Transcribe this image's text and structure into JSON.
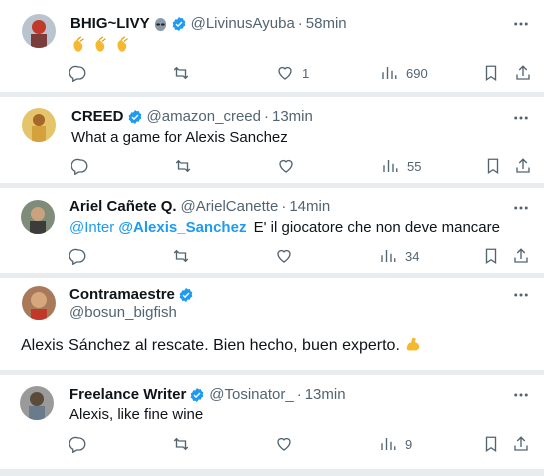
{
  "tweets": [
    {
      "name": "BHIG~LIVY",
      "handle": "@LivinusAyuba",
      "dot": "·",
      "time": "58min",
      "text": "",
      "emoji": [
        "clapping-hands",
        "clapping-hands",
        "clapping-hands"
      ],
      "replies": "",
      "retweets": "",
      "likes": "1",
      "views": "690"
    },
    {
      "name": "CREED",
      "handle": "@amazon_creed",
      "dot": "·",
      "time": "13min",
      "text": "What a game for Alexis Sanchez",
      "replies": "",
      "retweets": "",
      "likes": "",
      "views": "55"
    },
    {
      "name": "Ariel Cañete Q.",
      "handle": "@ArielCanette",
      "dot": "·",
      "time": "14min",
      "mention1": "@Inter",
      "mention2": "@Alexis_Sanchez",
      "text": "E' il giocatore che non deve mancare",
      "replies": "",
      "retweets": "",
      "likes": "",
      "views": "34"
    },
    {
      "name": "Contramaestre",
      "handle": "@bosun_bigfish",
      "text": "Alexis Sánchez al rescate. Bien hecho, buen experto.",
      "emoji": [
        "flexed-biceps"
      ]
    },
    {
      "name": "Freelance Writer",
      "handle": "@Tosinator_",
      "dot": "·",
      "time": "13min",
      "text": "Alexis, like fine wine",
      "replies": "",
      "retweets": "",
      "likes": "",
      "views": "9"
    }
  ],
  "colors": {
    "verified": "#1d9bf0",
    "secondary": "#536471",
    "mention": "#1d9bf0",
    "background": "#e9ecef"
  }
}
